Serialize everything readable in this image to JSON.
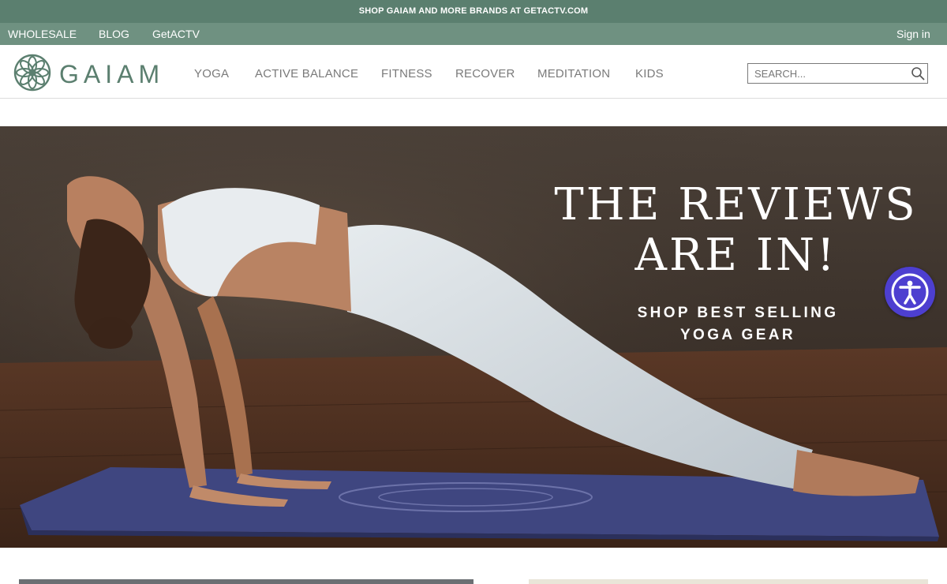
{
  "promo": {
    "text": "SHOP GAIAM AND MORE BRANDS AT GETACTV.COM"
  },
  "utility": {
    "links": [
      "WHOLESALE",
      "BLOG",
      "GetACTV"
    ],
    "sign_in": "Sign in"
  },
  "header": {
    "logo_text": "GAIAM",
    "nav": [
      "YOGA",
      "ACTIVE BALANCE",
      "FITNESS",
      "RECOVER",
      "MEDITATION",
      "KIDS"
    ],
    "search_placeholder": "SEARCH..."
  },
  "hero": {
    "headline_line1": "THE REVIEWS",
    "headline_line2": "ARE IN!",
    "subhead_line1": "SHOP BEST SELLING",
    "subhead_line2": "YOGA GEAR"
  },
  "colors": {
    "promo_bar": "#5b7f6f",
    "utility_bar": "#6f9181",
    "brand_green": "#5b7f6f",
    "accessibility_button": "#4d3fd0"
  },
  "icons": [
    "gaiam-flower-logo-icon",
    "search-icon",
    "accessibility-icon"
  ]
}
